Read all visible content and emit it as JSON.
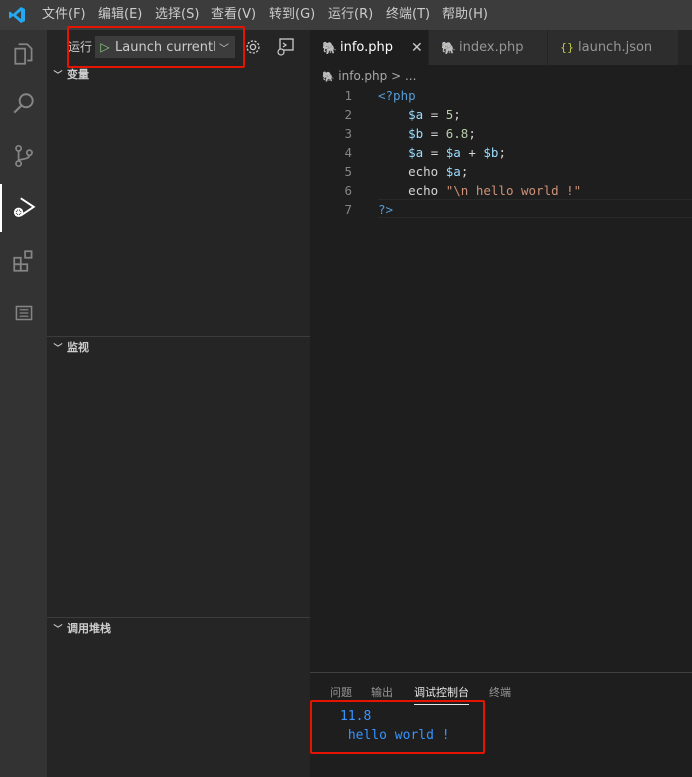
{
  "menubar": {
    "items": [
      "文件(F)",
      "编辑(E)",
      "选择(S)",
      "查看(V)",
      "转到(G)",
      "运行(R)",
      "终端(T)",
      "帮助(H)"
    ]
  },
  "activitybar": {
    "icons": [
      "explorer-icon",
      "search-icon",
      "source-control-icon",
      "run-debug-icon",
      "extensions-icon",
      "outline-icon"
    ]
  },
  "sidebar": {
    "run_label": "运行",
    "config_name": "Launch currently",
    "sections": {
      "variables": "变量",
      "watch": "监视",
      "callstack": "调用堆栈"
    }
  },
  "tabs": [
    {
      "label": "info.php",
      "icon": "php-icon",
      "active": true
    },
    {
      "label": "index.php",
      "icon": "php-icon",
      "active": false
    },
    {
      "label": "launch.json",
      "icon": "json-icon",
      "active": false
    }
  ],
  "breadcrumb": {
    "file": "info.php",
    "sep": ">",
    "more": "..."
  },
  "code": {
    "line_numbers": [
      "1",
      "2",
      "3",
      "4",
      "5",
      "6",
      "7"
    ],
    "lines": [
      [
        {
          "t": "<?php",
          "c": "php-tag"
        }
      ],
      [
        {
          "t": "    ",
          "c": "op"
        },
        {
          "t": "$a",
          "c": "var"
        },
        {
          "t": " = ",
          "c": "op"
        },
        {
          "t": "5",
          "c": "num"
        },
        {
          "t": ";",
          "c": "op"
        }
      ],
      [
        {
          "t": "    ",
          "c": "op"
        },
        {
          "t": "$b",
          "c": "var"
        },
        {
          "t": " = ",
          "c": "op"
        },
        {
          "t": "6.8",
          "c": "num"
        },
        {
          "t": ";",
          "c": "op"
        }
      ],
      [
        {
          "t": "    ",
          "c": "op"
        },
        {
          "t": "$a",
          "c": "var"
        },
        {
          "t": " = ",
          "c": "op"
        },
        {
          "t": "$a",
          "c": "var"
        },
        {
          "t": " + ",
          "c": "op"
        },
        {
          "t": "$b",
          "c": "var"
        },
        {
          "t": ";",
          "c": "op"
        }
      ],
      [
        {
          "t": "    ",
          "c": "op"
        },
        {
          "t": "echo",
          "c": "kw"
        },
        {
          "t": " ",
          "c": "op"
        },
        {
          "t": "$a",
          "c": "var"
        },
        {
          "t": ";",
          "c": "op"
        }
      ],
      [
        {
          "t": "    ",
          "c": "op"
        },
        {
          "t": "echo",
          "c": "kw"
        },
        {
          "t": " ",
          "c": "op"
        },
        {
          "t": "\"\\n hello world !\"",
          "c": "str"
        }
      ],
      [
        {
          "t": "?>",
          "c": "php-tag"
        }
      ]
    ]
  },
  "panel": {
    "tabs": [
      "问题",
      "输出",
      "调试控制台",
      "终端"
    ],
    "active_tab": "调试控制台",
    "console_output": [
      "11.8",
      " hello world !"
    ]
  },
  "colors": {
    "highlight_box": "#e51400",
    "console_text": "#3794ff"
  }
}
